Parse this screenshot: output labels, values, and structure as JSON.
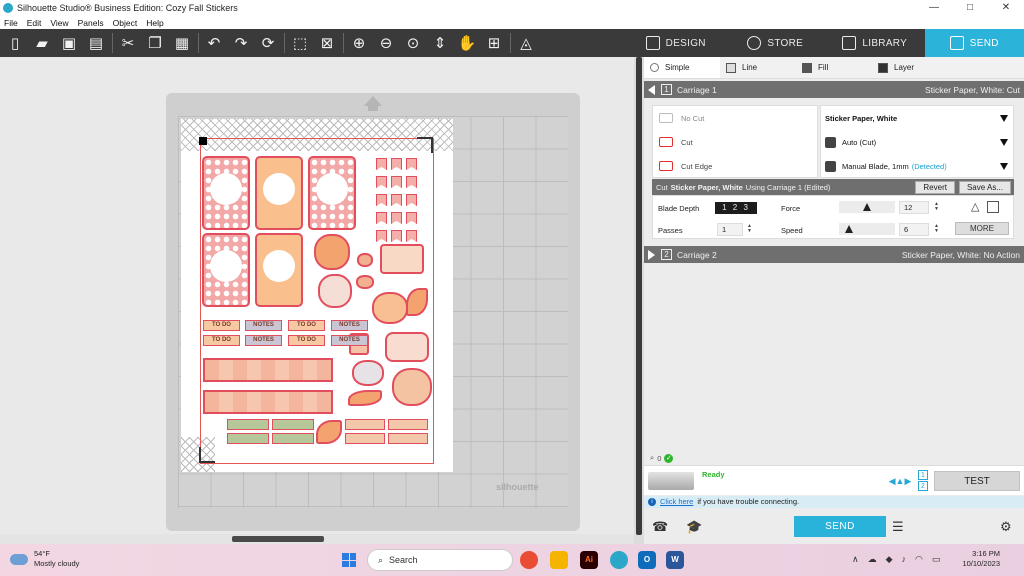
{
  "window": {
    "title": "Silhouette Studio® Business Edition: Cozy Fall Stickers",
    "controls": [
      "—",
      "□",
      "✕"
    ]
  },
  "menu": [
    "File",
    "Edit",
    "View",
    "Panels",
    "Object",
    "Help"
  ],
  "toolbar_icons": [
    "new-document-icon",
    "open-folder-icon",
    "save-icon",
    "print-icon",
    "cut-icon",
    "copy-icon",
    "paste-icon",
    "undo-icon",
    "redo-icon",
    "redraw-icon",
    "select-all-icon",
    "deselect-icon",
    "zoom-in-icon",
    "zoom-out-icon",
    "zoom-selected-icon",
    "drag-zoom-icon",
    "pan-icon",
    "fit-page-icon",
    "trace-icon"
  ],
  "nav_tabs": [
    {
      "label": "DESIGN",
      "icon": "grid-icon"
    },
    {
      "label": "STORE",
      "icon": "store-icon"
    },
    {
      "label": "LIBRARY",
      "icon": "library-icon"
    },
    {
      "label": "SEND",
      "icon": "cutter-icon",
      "active": true
    }
  ],
  "canvas": {
    "brand": "silhouette",
    "sticker_tags": {
      "todo": "TO DO",
      "notes": "NOTES"
    }
  },
  "send_panel": {
    "subtabs": [
      "Simple",
      "Line",
      "Fill",
      "Layer"
    ],
    "carriage1": {
      "num": "1",
      "label": "Carriage 1",
      "status": "Sticker Paper, White: Cut"
    },
    "cut_options": [
      "No Cut",
      "Cut",
      "Cut Edge"
    ],
    "material": "Sticker Paper, White",
    "tool": "Auto (Cut)",
    "blade": "Manual Blade, 1mm",
    "blade_detected": "(Detected)",
    "cut_bar": {
      "prefix": "Cut",
      "material": "Sticker Paper, White",
      "suffix": "Using Carriage 1 (Edited)"
    },
    "revert": "Revert",
    "save_as": "Save As...",
    "blade_depth_label": "Blade Depth",
    "blade_depth_dial": "1 2 3",
    "passes_label": "Passes",
    "passes": "1",
    "force_label": "Force",
    "force": "12",
    "speed_label": "Speed",
    "speed": "6",
    "more": "MORE",
    "carriage2": {
      "num": "2",
      "label": "Carriage 2",
      "status": "Sticker Paper, White: No Action"
    },
    "count": "0",
    "device_status": "Ready",
    "page_nums": [
      "1",
      "2"
    ],
    "test": "TEST",
    "info_link": "Click here",
    "info_text": "if you have trouble connecting.",
    "send": "SEND"
  },
  "taskbar": {
    "temp": "54°F",
    "weather": "Mostly cloudy",
    "search_placeholder": "Search",
    "time": "3:16 PM",
    "date": "10/10/2023"
  }
}
